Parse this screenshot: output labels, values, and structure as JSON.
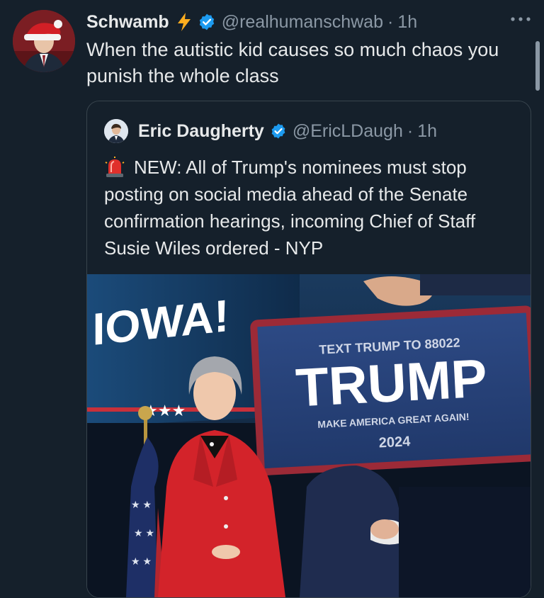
{
  "tweet": {
    "display_name": "Schwamb",
    "handle": "@realhumanschwab",
    "separator": "·",
    "time": "1h",
    "text": "When the autistic kid causes so much chaos you punish the whole class"
  },
  "quoted_tweet": {
    "display_name": "Eric Daugherty",
    "handle": "@EricLDaugh",
    "separator": "·",
    "time": "1h",
    "text": "NEW: All of Trump's nominees must stop posting on social media ahead of the Senate confirmation hearings, incoming Chief of Staff Susie Wiles ordered - NYP"
  },
  "photo": {
    "banner_text": "IOWA!",
    "sign_top": "TEXT TRUMP TO 88022",
    "sign_main": "TRUMP",
    "sign_sub": "MAKE AMERICA GREAT AGAIN!",
    "sign_year": "2024"
  },
  "icons": {
    "bolt": "lightning-icon",
    "verified": "verified-badge-icon",
    "more": "more-icon",
    "siren": "siren-emoji-icon"
  },
  "colors": {
    "background": "#15202b",
    "text": "#e7e9ea",
    "secondary_text": "#8b98a5",
    "verified_blue": "#1d9bf0",
    "bolt_yellow": "#ffad1f",
    "border": "#38444d"
  }
}
